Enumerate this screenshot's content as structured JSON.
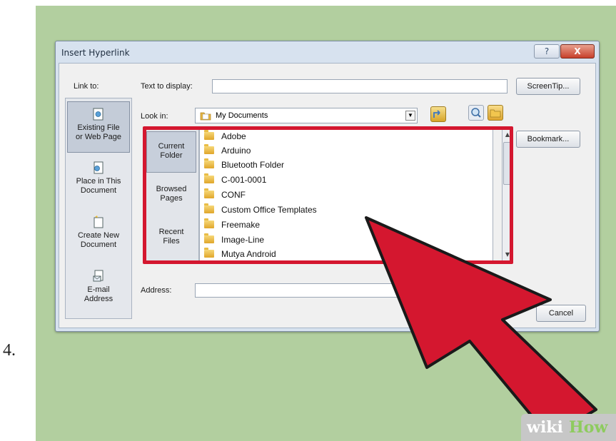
{
  "step": {
    "number": "4."
  },
  "dialog": {
    "title": "Insert Hyperlink",
    "help_label": "?",
    "close_label": "X",
    "link_to_label": "Link to:",
    "text_to_display_label": "Text to display:",
    "text_to_display_value": "",
    "screentip_label": "ScreenTip...",
    "look_in_label": "Look in:",
    "look_in_value": "My Documents",
    "bookmark_label": "Bookmark...",
    "address_label": "Address:",
    "address_value": "",
    "cancel_label": "Cancel",
    "places": [
      {
        "label_1": "Existing File",
        "label_2": "or Web Page"
      },
      {
        "label_1": "Place in This",
        "label_2": "Document"
      },
      {
        "label_1": "Create New",
        "label_2": "Document"
      },
      {
        "label_1": "E-mail",
        "label_2": "Address"
      }
    ],
    "subplaces": [
      {
        "label_1": "Current",
        "label_2": "Folder"
      },
      {
        "label_1": "Browsed",
        "label_2": "Pages"
      },
      {
        "label_1": "Recent",
        "label_2": "Files"
      }
    ],
    "files": [
      "Adobe",
      "Arduino",
      "Bluetooth Folder",
      "C-001-0001",
      "CONF",
      "Custom Office Templates",
      "Freemake",
      "Image-Line",
      "Mutya Android"
    ]
  },
  "watermark": {
    "part1": "wiki",
    "part2": "How"
  },
  "colors": {
    "background": "#b2cf9f",
    "highlight": "#d4172f",
    "cursor": "#d4172f"
  }
}
